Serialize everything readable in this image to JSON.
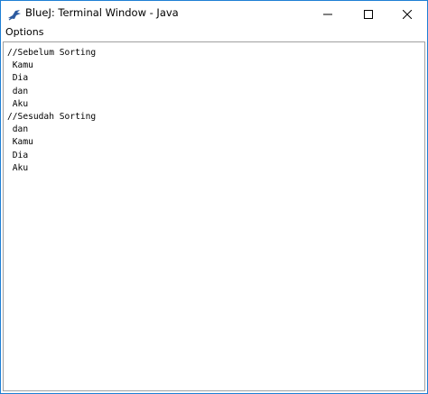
{
  "window": {
    "title": "BlueJ: Terminal Window - Java",
    "controls": {
      "minimize_icon": "minimize-icon",
      "maximize_icon": "maximize-icon",
      "close_icon": "close-icon"
    }
  },
  "menu": {
    "items": [
      {
        "label": "Options"
      }
    ]
  },
  "terminal": {
    "lines": [
      "//Sebelum Sorting",
      " Kamu",
      " Dia",
      " dan",
      " Aku",
      "//Sesudah Sorting",
      " dan",
      " Kamu",
      " Dia",
      " Aku"
    ]
  },
  "colors": {
    "border_accent": "#1e7fd4",
    "icon_blue": "#2c5aa0",
    "background": "#ffffff",
    "text": "#000000"
  }
}
